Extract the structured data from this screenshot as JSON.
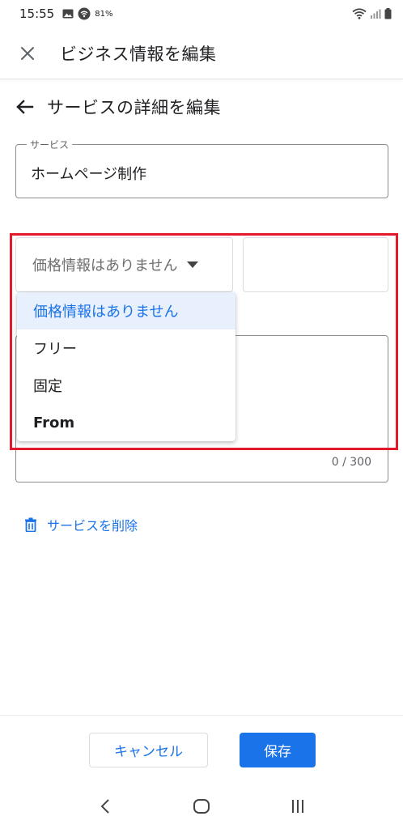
{
  "status_bar": {
    "time": "15:55",
    "battery_percent": "81%"
  },
  "app_bar": {
    "title": "ビジネス情報を編集",
    "close_icon": "close-icon"
  },
  "sub_header": {
    "title": "サービスの詳細を編集",
    "back_icon": "arrow-back-icon"
  },
  "service_field": {
    "label": "サービス",
    "value": "ホームページ制作"
  },
  "price": {
    "selected": "価格情報はありません",
    "options": [
      "価格情報はありません",
      "フリー",
      "固定",
      "From"
    ]
  },
  "description": {
    "counter": "0 / 300"
  },
  "delete": {
    "label": "サービスを削除",
    "icon": "trash-icon"
  },
  "footer": {
    "cancel_label": "キャンセル",
    "save_label": "保存"
  },
  "colors": {
    "accent": "#1a73e8",
    "highlight": "#e21b2c",
    "selected_bg": "#e8f0fe"
  }
}
